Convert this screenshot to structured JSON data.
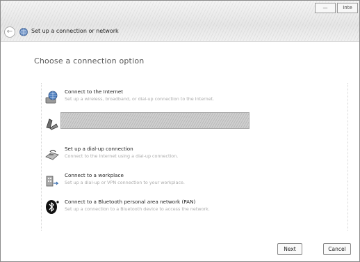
{
  "window": {
    "title": "Set up a connection or network",
    "min_label": "—",
    "close_label": "Inte"
  },
  "main": {
    "heading": "Choose a connection option",
    "options": [
      {
        "label": "Connect to the Internet",
        "description": "Set up a wireless, broadband, or dial-up connection to the Internet.",
        "icon": "globe-network-icon"
      },
      {
        "label": "",
        "description": "",
        "icon": "router-icon"
      },
      {
        "label": "Set up a dial-up connection",
        "description": "Connect to the Internet using a dial-up connection.",
        "icon": "modem-icon"
      },
      {
        "label": "Connect to a workplace",
        "description": "Set up a dial-up or VPN connection to your workplace.",
        "icon": "workplace-icon"
      },
      {
        "label": "Connect to a Bluetooth personal area network (PAN)",
        "description": "Set up a connection to a Bluetooth device to access the network.",
        "icon": "bluetooth-icon"
      }
    ]
  },
  "footer": {
    "next_label": "Next",
    "cancel_label": "Cancel"
  },
  "colors": {
    "title_text": "#222222",
    "heading_text": "#555555",
    "selected_bg": "#cfcfcf"
  }
}
